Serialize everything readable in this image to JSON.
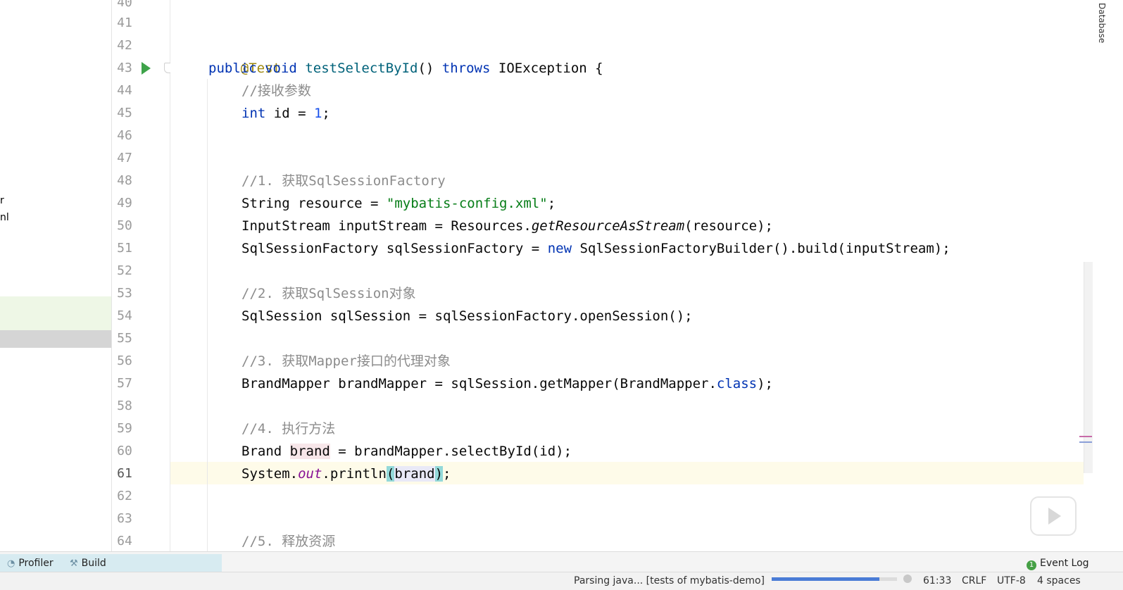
{
  "left_panel": {
    "fragments": [
      "r",
      "nl"
    ]
  },
  "gutter": {
    "line_numbers": [
      "40",
      "41",
      "42",
      "43",
      "44",
      "45",
      "46",
      "47",
      "48",
      "49",
      "50",
      "51",
      "52",
      "53",
      "54",
      "55",
      "56",
      "57",
      "58",
      "59",
      "60",
      "61",
      "62",
      "63",
      "64"
    ],
    "current_line": "61",
    "run_icon": "run-test-icon",
    "fold_icon": "fold-marker-icon"
  },
  "code": {
    "l42_annotation": "@Test",
    "l43_kw1": "public",
    "l43_kw2": "void",
    "l43_method": "testSelectById",
    "l43_parens": "() ",
    "l43_throws": "throws",
    "l43_rest": " IOException {",
    "l44_comment": "//接收参数",
    "l45_kw": "int",
    "l45_mid": " id = ",
    "l45_num": "1",
    "l45_end": ";",
    "l48_comment": "//1. 获取SqlSessionFactory",
    "l49_start": "String resource = ",
    "l49_str": "\"mybatis-config.xml\"",
    "l49_end": ";",
    "l50_start": "InputStream inputStream = Resources.",
    "l50_italic": "getResourceAsStream",
    "l50_end": "(resource);",
    "l51_start": "SqlSessionFactory sqlSessionFactory = ",
    "l51_new": "new",
    "l51_end": " SqlSessionFactoryBuilder().build(inputStream);",
    "l53_comment": "//2. 获取SqlSession对象",
    "l54_code": "SqlSession sqlSession = sqlSessionFactory.openSession();",
    "l56_comment": "//3. 获取Mapper接口的代理对象",
    "l57_start": "BrandMapper brandMapper = sqlSession.getMapper(BrandMapper.",
    "l57_class": "class",
    "l57_end": ");",
    "l59_comment": "//4. 执行方法",
    "l60_start": "Brand ",
    "l60_var": "brand",
    "l60_end": " = brandMapper.selectById(id);",
    "l61_start": "System.",
    "l61_out": "out",
    "l61_mid": ".println",
    "l61_open": "(",
    "l61_var": "brand",
    "l61_close": ")",
    "l61_end": ";",
    "l64_comment": "//5. 释放资源"
  },
  "right_strip": {
    "database_tab": "Database"
  },
  "toolbar": {
    "profiler_label": "Profiler",
    "profiler_icon": "profiler-icon",
    "build_label": "Build",
    "build_icon": "hammer-icon",
    "event_log_label": "Event Log",
    "event_log_badge": "1"
  },
  "status": {
    "task_text": "Parsing java... [tests of mybatis-demo]",
    "progress_fraction": 0.86,
    "cursor_position": "61:33",
    "line_separator": "CRLF",
    "encoding": "UTF-8",
    "indent": "4 spaces"
  }
}
